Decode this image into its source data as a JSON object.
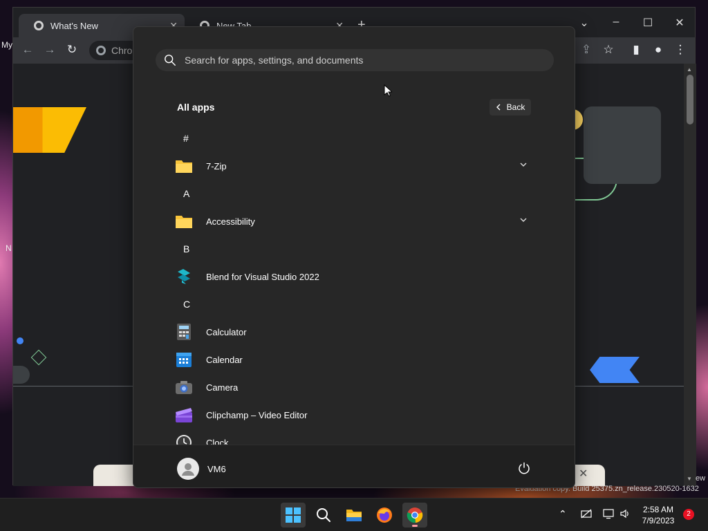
{
  "desktop": {
    "left_label_1": "My",
    "left_label_2": "N",
    "watermark": "Evaluation copy. Build 25375.zn_release.230520-1632",
    "right_edge_text": "ew"
  },
  "browser": {
    "tabs": [
      {
        "title": "What's New"
      },
      {
        "title": "New Tab"
      }
    ],
    "omnibox_text": "Chro"
  },
  "start_menu": {
    "search_placeholder": "Search for apps, settings, and documents",
    "section_title": "All apps",
    "back_label": "Back",
    "groups": [
      {
        "letter": "#",
        "apps": [
          {
            "name": "7-Zip",
            "icon": "folder-icon",
            "expandable": true
          }
        ]
      },
      {
        "letter": "A",
        "apps": [
          {
            "name": "Accessibility",
            "icon": "folder-icon",
            "expandable": true
          }
        ]
      },
      {
        "letter": "B",
        "apps": [
          {
            "name": "Blend for Visual Studio 2022",
            "icon": "blend-icon",
            "expandable": false
          }
        ]
      },
      {
        "letter": "C",
        "apps": [
          {
            "name": "Calculator",
            "icon": "calculator-icon",
            "expandable": false
          },
          {
            "name": "Calendar",
            "icon": "calendar-icon",
            "expandable": false
          },
          {
            "name": "Camera",
            "icon": "camera-icon",
            "expandable": false
          },
          {
            "name": "Clipchamp – Video Editor",
            "icon": "clipchamp-icon",
            "expandable": false
          },
          {
            "name": "Clock",
            "icon": "clock-icon",
            "expandable": false
          }
        ]
      }
    ],
    "user_name": "VM6"
  },
  "taskbar": {
    "time": "2:58 AM",
    "date": "7/9/2023",
    "notification_count": "2"
  },
  "colors": {
    "start_bg": "#272727",
    "folder_yellow": "#f8c43a",
    "taskbar_bg": "#1f1f1f"
  }
}
